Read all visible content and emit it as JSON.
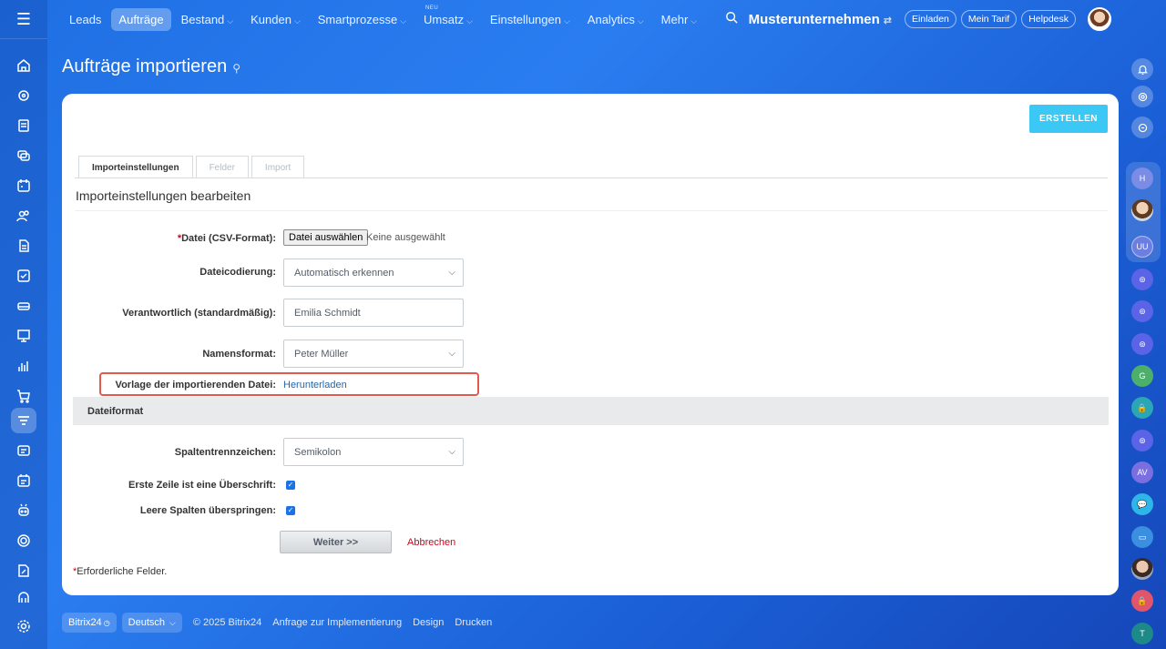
{
  "topnav": {
    "items": [
      {
        "label": "Leads",
        "chevron": false,
        "active": false
      },
      {
        "label": "Aufträge",
        "chevron": false,
        "active": true
      },
      {
        "label": "Bestand",
        "chevron": true,
        "active": false
      },
      {
        "label": "Kunden",
        "chevron": true,
        "active": false
      },
      {
        "label": "Smartprozesse",
        "chevron": true,
        "active": false
      },
      {
        "label": "Umsatz",
        "chevron": true,
        "active": false,
        "tag": "NEU"
      },
      {
        "label": "Einstellungen",
        "chevron": true,
        "active": false
      },
      {
        "label": "Analytics",
        "chevron": true,
        "active": false
      },
      {
        "label": "Mehr",
        "chevron": true,
        "active": false
      }
    ],
    "company": "Musterunternehmen",
    "invite_label": "Einladen",
    "tariff_label": "Mein Tarif",
    "helpdesk_label": "Helpdesk"
  },
  "page": {
    "title": "Aufträge importieren",
    "create_button": "ERSTELLEN"
  },
  "tabs": [
    "Importeinstellungen",
    "Felder",
    "Import"
  ],
  "form": {
    "section_title": "Importeinstellungen bearbeiten",
    "file_label": "Datei (CSV-Format):",
    "file_button": "Datei auswählen",
    "file_status": "Keine ausgewählt",
    "encoding_label": "Dateicodierung:",
    "encoding_value": "Automatisch erkennen",
    "responsible_label": "Verantwortlich (standardmäßig):",
    "responsible_value": "Emilia Schmidt",
    "name_format_label": "Namensformat:",
    "name_format_value": "Peter Müller",
    "template_label": "Vorlage der importierenden Datei:",
    "template_link": "Herunterladen",
    "file_format_header": "Dateiformat",
    "separator_label": "Spaltentrennzeichen:",
    "separator_value": "Semikolon",
    "first_row_header_label": "Erste Zeile ist eine Überschrift:",
    "first_row_header_checked": true,
    "skip_empty_label": "Leere Spalten überspringen:",
    "skip_empty_checked": true,
    "next_button": "Weiter >>",
    "cancel_link": "Abbrechen",
    "required_note": "Erforderliche Felder."
  },
  "footer": {
    "brand": "Bitrix24",
    "language": "Deutsch",
    "copyright": "© 2025 Bitrix24",
    "links": [
      "Anfrage zur Implementierung",
      "Design",
      "Drucken"
    ]
  },
  "rightbar": {
    "initials": [
      "H",
      "UU",
      "G",
      "AV",
      "T"
    ]
  },
  "colors": {
    "accent": "#3bc8f5",
    "link": "#2067b0",
    "danger": "#d0021b",
    "highlight": "#e05a4e"
  }
}
